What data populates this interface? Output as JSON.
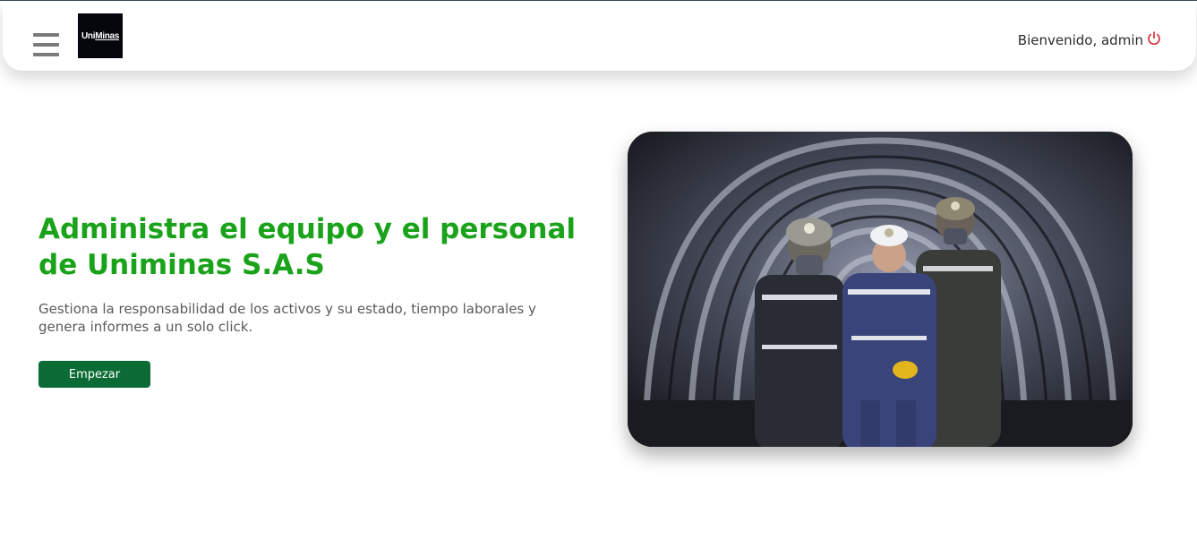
{
  "header": {
    "logo_text_a": "Uni",
    "logo_text_b": "Minas",
    "welcome": "Bienvenido, admin",
    "power_icon": "power-icon",
    "menu_icon": "hamburger-menu-icon"
  },
  "hero": {
    "title": "Administra el equipo y el personal de Uniminas S.A.S",
    "subtitle": "Gestiona la responsabilidad de los activos y su estado, tiempo laborales y genera informes a un solo click.",
    "button_label": "Empezar"
  },
  "colors": {
    "title_green": "#1aa31a",
    "button_green": "#0b6b35",
    "power_red": "#d9232e"
  }
}
